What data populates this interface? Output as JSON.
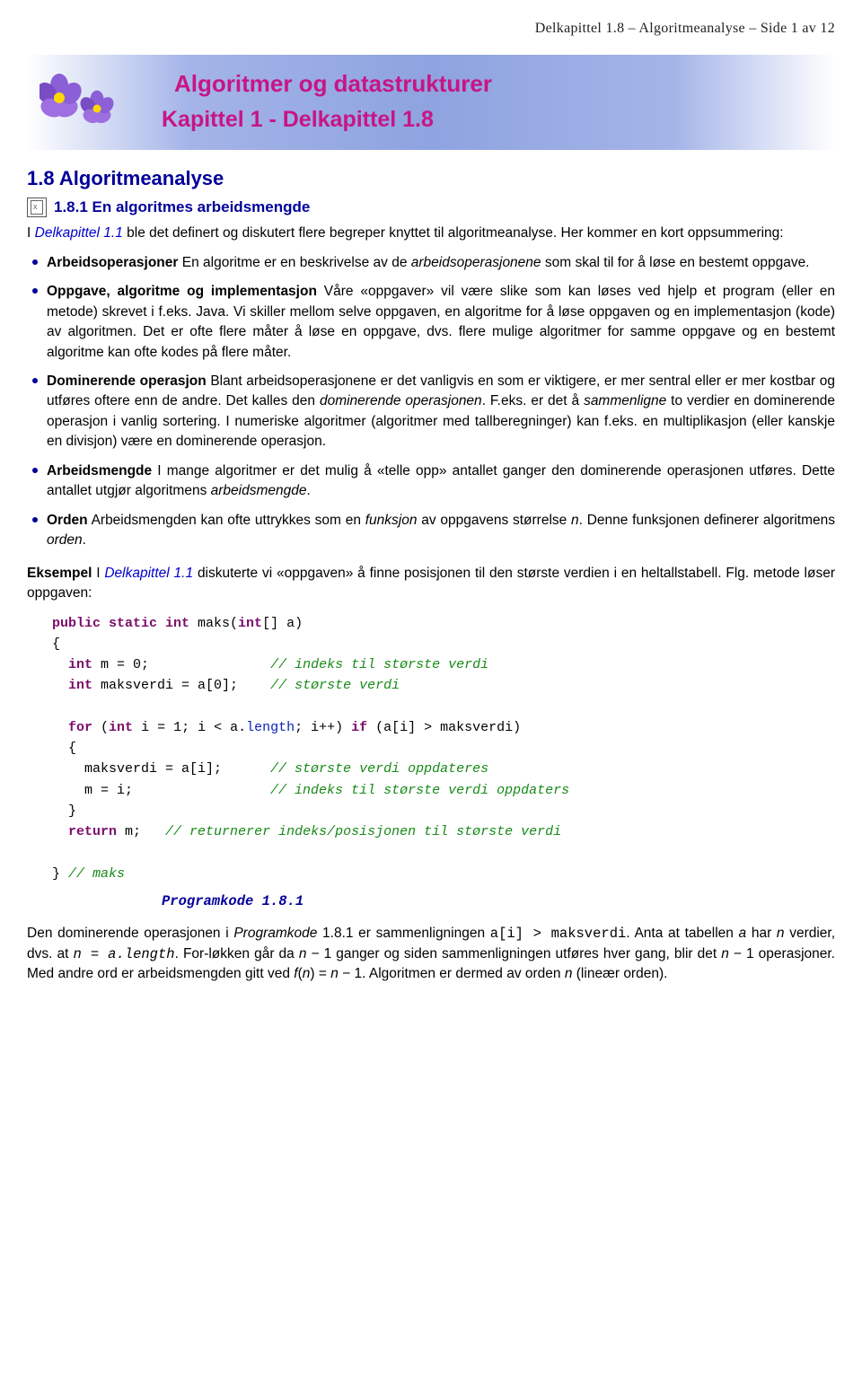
{
  "header": "Delkapittel 1.8 – Algoritmeanalyse – Side 1 av 12",
  "banner": {
    "title": "Algoritmer og datastrukturer",
    "subtitle": "Kapittel 1 - Delkapittel 1.8"
  },
  "section": "1.8  Algoritmeanalyse",
  "subsection": "1.8.1  En algoritmes arbeidsmengde",
  "intro_prefix": "I ",
  "intro_link": "Delkapittel 1.1",
  "intro_rest": " ble det definert og diskutert flere begreper knyttet til algoritmeanalyse. Her kommer en kort oppsummering:",
  "bullets": [
    {
      "term": "Arbeidsoperasjoner",
      "text_before": " En algoritme er en beskrivelse av de ",
      "italic": "arbeidsoperasjonene",
      "text_after": " som skal til for å løse en bestemt oppgave."
    }
  ],
  "b2_term": "Oppgave, algoritme og implementasjon",
  "b2_text": " Våre «oppgaver» vil være slike som kan løses ved hjelp et program (eller en metode) skrevet i f.eks. Java. Vi skiller mellom selve oppgaven, en algoritme for å løse oppgaven og en implementasjon (kode) av algoritmen. Det er ofte flere måter å løse en oppgave, dvs. flere mulige algoritmer for samme oppgave og en bestemt algoritme kan ofte kodes på flere måter.",
  "b3_term": "Dominerende operasjon",
  "b3_t1": " Blant arbeidsoperasjonene er det vanligvis en som er viktigere, er mer sentral eller er mer kostbar og utføres oftere enn de andre. Det kalles den ",
  "b3_i1": "dominerende operasjonen",
  "b3_t2": ". F.eks. er det å ",
  "b3_i2": "sammenligne",
  "b3_t3": " to verdier en dominerende operasjon i vanlig sortering. I numeriske algoritmer (algoritmer med tallberegninger) kan f.eks. en multiplikasjon (eller kanskje en divisjon) være en dominerende operasjon.",
  "b4_term": "Arbeidsmengde",
  "b4_t1": " I mange algoritmer er det mulig å «telle opp» antallet ganger den dominerende operasjonen utføres. Dette antallet utgjør algoritmens ",
  "b4_i1": "arbeidsmengde",
  "b4_t2": ".",
  "b5_term": "Orden",
  "b5_t1": " Arbeidsmengden kan ofte uttrykkes som en ",
  "b5_i1": "funksjon",
  "b5_t2": " av oppgavens størrelse ",
  "b5_i2": "n",
  "b5_t3": ". Denne funksjonen definerer algoritmens ",
  "b5_i3": "orden",
  "b5_t4": ".",
  "eksempel_label": "Eksempel",
  "eksempel_prefix": "  I ",
  "eksempel_link": "Delkapittel 1.1",
  "eksempel_rest": " diskuterte vi «oppgaven» å finne posisjonen til den største verdien i en heltallstabell. Flg. metode løser oppgaven:",
  "program_label": "Programkode 1.8.1",
  "closing_t1": "Den dominerende operasjonen i ",
  "closing_i1": "Programkode",
  "closing_t2": " 1.8.1 er sammenligningen ",
  "closing_code": "a[i] > maksverdi",
  "closing_t3": ". Anta at tabellen ",
  "closing_i2": "a",
  "closing_t4": " har ",
  "closing_i3": "n",
  "closing_t5": " verdier, dvs. at ",
  "closing_i4": "n = a.length",
  "closing_t6": ". For-løkken går da ",
  "closing_i5": "n",
  "closing_t7": " − 1 ganger og siden sammenligningen utføres hver gang, blir det ",
  "closing_i6": "n",
  "closing_t8": " − 1 operasjoner. Med andre ord er arbeidsmengden gitt ved ",
  "closing_i7": "f",
  "closing_t9": "(",
  "closing_i8": "n",
  "closing_t10": ") = ",
  "closing_i9": "n",
  "closing_t11": " − 1. Algoritmen er dermed av orden ",
  "closing_i10": "n",
  "closing_t12": " (lineær orden)."
}
